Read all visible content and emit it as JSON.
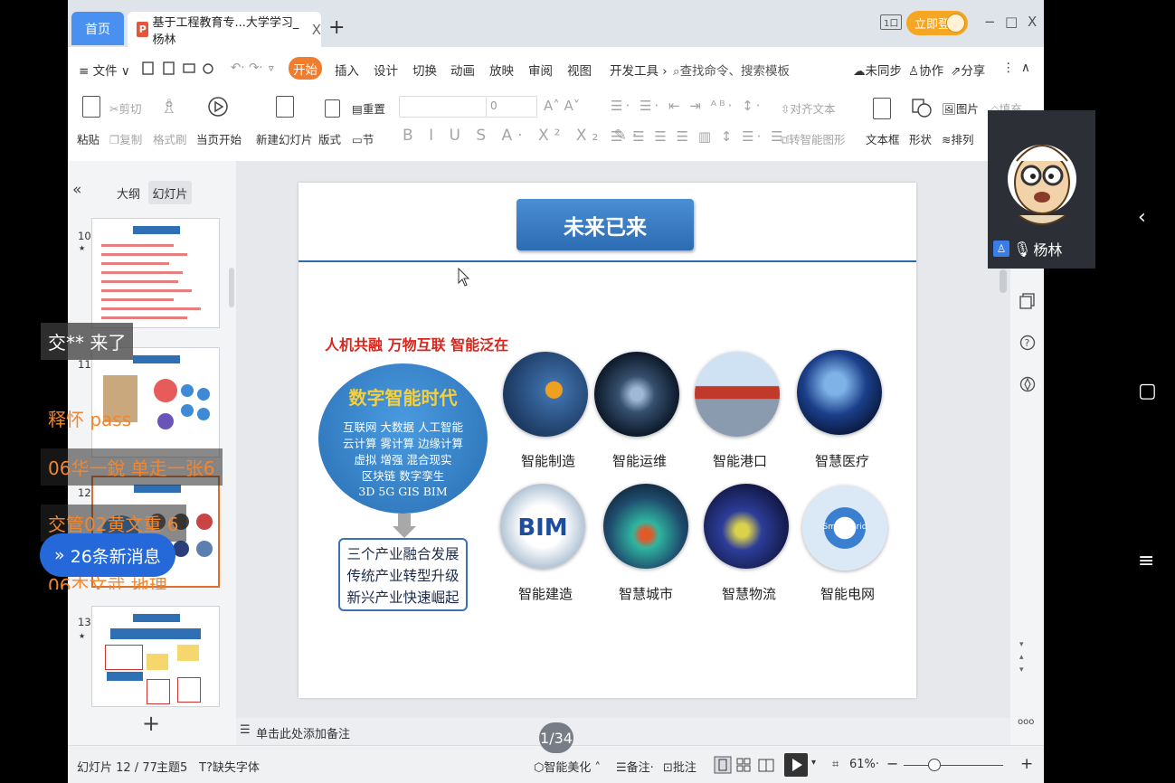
{
  "tabs": {
    "home": "首页",
    "doc_icon": "P",
    "doc": "基于工程教育专...大学学习_杨林",
    "close": "X",
    "add": "+"
  },
  "window": {
    "layout_icon": "1口",
    "login": "立即登录",
    "minimize": "−",
    "maximize": "□",
    "close": "X"
  },
  "menu": {
    "file": "≡ 文件 ∨",
    "items": [
      "开始",
      "插入",
      "设计",
      "切换",
      "动画",
      "放映",
      "审阅",
      "视图",
      "开发工具 ›"
    ],
    "search": "查找命令、搜索模板",
    "sync": "未同步",
    "collab": "协作",
    "share": "分享",
    "more": "⋮",
    "collapse": "∧"
  },
  "ribbon": {
    "paste": "粘贴",
    "cut": "剪切",
    "copy": "复制",
    "format_painter": "格式刷",
    "play_from_current": "当页开始",
    "new_slide": "新建幻灯片",
    "layout": "版式",
    "reset": "重置",
    "section": "节",
    "font_size": "0",
    "align_text": "对齐文本",
    "smart_graphic": "转智能图形",
    "textbox": "文本框",
    "shape": "形状",
    "picture": "图片",
    "fill": "填充",
    "arrange": "排列"
  },
  "left_panel": {
    "collapse": "«",
    "outline_tab": "大纲",
    "slides_tab": "幻灯片",
    "thumbnails": [
      {
        "num": "10"
      },
      {
        "num": "11"
      },
      {
        "num": "12"
      },
      {
        "num": "13"
      }
    ],
    "star": "★",
    "add": "+"
  },
  "slide": {
    "title": "未来已来",
    "tagline": "人机共融 万物互联 智能泛在",
    "ellipse_title": "数字智能时代",
    "ellipse_lines": [
      "互联网 大数据 人工智能",
      "云计算 雾计算 边缘计算",
      "虚拟 增强 混合现实",
      "区块链 数字孪生",
      "3D 5G GIS BIM"
    ],
    "box_lines": [
      "三个产业融合发展",
      "传统产业转型升级",
      "新兴产业快速崛起"
    ],
    "items": [
      "智能制造",
      "智能运维",
      "智能港口",
      "智慧医疗",
      "智能建造",
      "智慧城市",
      "智慧物流",
      "智能电网"
    ],
    "bim_text": "BIM",
    "grid_text": "Smart Grid"
  },
  "notes": {
    "placeholder": "单击此处添加备注"
  },
  "status": {
    "slide_info": "幻灯片 12 / 77",
    "theme": "主题5",
    "missing_font": "缺失字体",
    "beautify": "智能美化",
    "notes": "备注",
    "comments": "批注",
    "zoom": "61%",
    "zoom_minus": "−",
    "zoom_plus": "+",
    "more": "ooo"
  },
  "page_indicator": "1/34",
  "camera": {
    "name": "杨林"
  },
  "chat": {
    "msg1": "交** 来了",
    "msg2": "释怀  pass",
    "msg3": "06华一銳  单走一张6",
    "msg4": "交管02黄文重  6",
    "msg5": "06杰文武  地理",
    "new_messages": "26条新消息"
  },
  "android_nav": {
    "back": "‹",
    "home": "▢",
    "menu": "≡"
  },
  "colors": {
    "accent": "#f07c2e",
    "slide_blue": "#2e6aad",
    "red": "#d8261d",
    "chat_blue": "#2468d9"
  }
}
